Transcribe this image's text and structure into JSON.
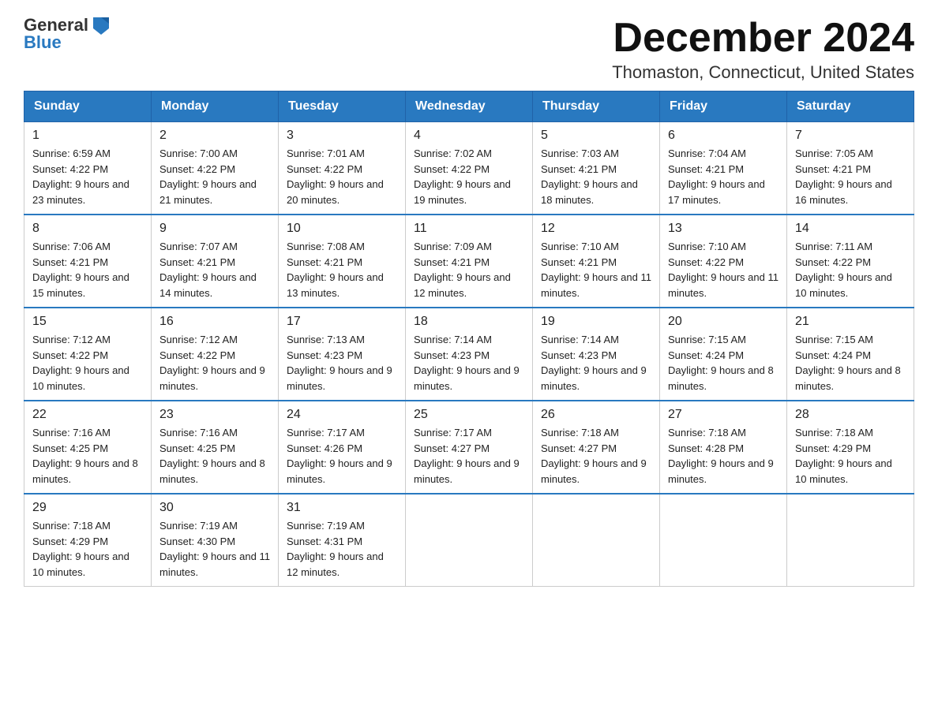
{
  "header": {
    "logo_general": "General",
    "logo_blue": "Blue",
    "month_title": "December 2024",
    "location": "Thomaston, Connecticut, United States"
  },
  "days_of_week": [
    "Sunday",
    "Monday",
    "Tuesday",
    "Wednesday",
    "Thursday",
    "Friday",
    "Saturday"
  ],
  "weeks": [
    [
      {
        "day": "1",
        "sunrise": "Sunrise: 6:59 AM",
        "sunset": "Sunset: 4:22 PM",
        "daylight": "Daylight: 9 hours and 23 minutes."
      },
      {
        "day": "2",
        "sunrise": "Sunrise: 7:00 AM",
        "sunset": "Sunset: 4:22 PM",
        "daylight": "Daylight: 9 hours and 21 minutes."
      },
      {
        "day": "3",
        "sunrise": "Sunrise: 7:01 AM",
        "sunset": "Sunset: 4:22 PM",
        "daylight": "Daylight: 9 hours and 20 minutes."
      },
      {
        "day": "4",
        "sunrise": "Sunrise: 7:02 AM",
        "sunset": "Sunset: 4:22 PM",
        "daylight": "Daylight: 9 hours and 19 minutes."
      },
      {
        "day": "5",
        "sunrise": "Sunrise: 7:03 AM",
        "sunset": "Sunset: 4:21 PM",
        "daylight": "Daylight: 9 hours and 18 minutes."
      },
      {
        "day": "6",
        "sunrise": "Sunrise: 7:04 AM",
        "sunset": "Sunset: 4:21 PM",
        "daylight": "Daylight: 9 hours and 17 minutes."
      },
      {
        "day": "7",
        "sunrise": "Sunrise: 7:05 AM",
        "sunset": "Sunset: 4:21 PM",
        "daylight": "Daylight: 9 hours and 16 minutes."
      }
    ],
    [
      {
        "day": "8",
        "sunrise": "Sunrise: 7:06 AM",
        "sunset": "Sunset: 4:21 PM",
        "daylight": "Daylight: 9 hours and 15 minutes."
      },
      {
        "day": "9",
        "sunrise": "Sunrise: 7:07 AM",
        "sunset": "Sunset: 4:21 PM",
        "daylight": "Daylight: 9 hours and 14 minutes."
      },
      {
        "day": "10",
        "sunrise": "Sunrise: 7:08 AM",
        "sunset": "Sunset: 4:21 PM",
        "daylight": "Daylight: 9 hours and 13 minutes."
      },
      {
        "day": "11",
        "sunrise": "Sunrise: 7:09 AM",
        "sunset": "Sunset: 4:21 PM",
        "daylight": "Daylight: 9 hours and 12 minutes."
      },
      {
        "day": "12",
        "sunrise": "Sunrise: 7:10 AM",
        "sunset": "Sunset: 4:21 PM",
        "daylight": "Daylight: 9 hours and 11 minutes."
      },
      {
        "day": "13",
        "sunrise": "Sunrise: 7:10 AM",
        "sunset": "Sunset: 4:22 PM",
        "daylight": "Daylight: 9 hours and 11 minutes."
      },
      {
        "day": "14",
        "sunrise": "Sunrise: 7:11 AM",
        "sunset": "Sunset: 4:22 PM",
        "daylight": "Daylight: 9 hours and 10 minutes."
      }
    ],
    [
      {
        "day": "15",
        "sunrise": "Sunrise: 7:12 AM",
        "sunset": "Sunset: 4:22 PM",
        "daylight": "Daylight: 9 hours and 10 minutes."
      },
      {
        "day": "16",
        "sunrise": "Sunrise: 7:12 AM",
        "sunset": "Sunset: 4:22 PM",
        "daylight": "Daylight: 9 hours and 9 minutes."
      },
      {
        "day": "17",
        "sunrise": "Sunrise: 7:13 AM",
        "sunset": "Sunset: 4:23 PM",
        "daylight": "Daylight: 9 hours and 9 minutes."
      },
      {
        "day": "18",
        "sunrise": "Sunrise: 7:14 AM",
        "sunset": "Sunset: 4:23 PM",
        "daylight": "Daylight: 9 hours and 9 minutes."
      },
      {
        "day": "19",
        "sunrise": "Sunrise: 7:14 AM",
        "sunset": "Sunset: 4:23 PM",
        "daylight": "Daylight: 9 hours and 9 minutes."
      },
      {
        "day": "20",
        "sunrise": "Sunrise: 7:15 AM",
        "sunset": "Sunset: 4:24 PM",
        "daylight": "Daylight: 9 hours and 8 minutes."
      },
      {
        "day": "21",
        "sunrise": "Sunrise: 7:15 AM",
        "sunset": "Sunset: 4:24 PM",
        "daylight": "Daylight: 9 hours and 8 minutes."
      }
    ],
    [
      {
        "day": "22",
        "sunrise": "Sunrise: 7:16 AM",
        "sunset": "Sunset: 4:25 PM",
        "daylight": "Daylight: 9 hours and 8 minutes."
      },
      {
        "day": "23",
        "sunrise": "Sunrise: 7:16 AM",
        "sunset": "Sunset: 4:25 PM",
        "daylight": "Daylight: 9 hours and 8 minutes."
      },
      {
        "day": "24",
        "sunrise": "Sunrise: 7:17 AM",
        "sunset": "Sunset: 4:26 PM",
        "daylight": "Daylight: 9 hours and 9 minutes."
      },
      {
        "day": "25",
        "sunrise": "Sunrise: 7:17 AM",
        "sunset": "Sunset: 4:27 PM",
        "daylight": "Daylight: 9 hours and 9 minutes."
      },
      {
        "day": "26",
        "sunrise": "Sunrise: 7:18 AM",
        "sunset": "Sunset: 4:27 PM",
        "daylight": "Daylight: 9 hours and 9 minutes."
      },
      {
        "day": "27",
        "sunrise": "Sunrise: 7:18 AM",
        "sunset": "Sunset: 4:28 PM",
        "daylight": "Daylight: 9 hours and 9 minutes."
      },
      {
        "day": "28",
        "sunrise": "Sunrise: 7:18 AM",
        "sunset": "Sunset: 4:29 PM",
        "daylight": "Daylight: 9 hours and 10 minutes."
      }
    ],
    [
      {
        "day": "29",
        "sunrise": "Sunrise: 7:18 AM",
        "sunset": "Sunset: 4:29 PM",
        "daylight": "Daylight: 9 hours and 10 minutes."
      },
      {
        "day": "30",
        "sunrise": "Sunrise: 7:19 AM",
        "sunset": "Sunset: 4:30 PM",
        "daylight": "Daylight: 9 hours and 11 minutes."
      },
      {
        "day": "31",
        "sunrise": "Sunrise: 7:19 AM",
        "sunset": "Sunset: 4:31 PM",
        "daylight": "Daylight: 9 hours and 12 minutes."
      },
      null,
      null,
      null,
      null
    ]
  ]
}
